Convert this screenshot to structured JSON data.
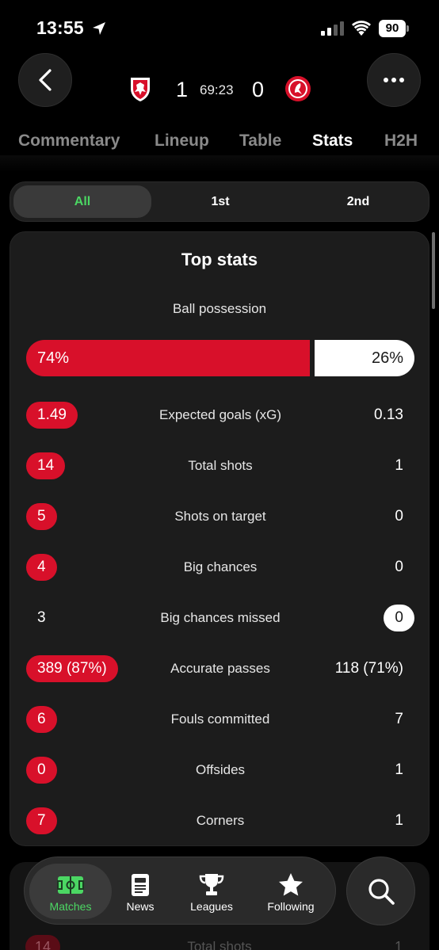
{
  "status_bar": {
    "time": "13:55",
    "battery": "90"
  },
  "header": {
    "home_score": "1",
    "away_score": "0",
    "match_clock": "69:23",
    "home_color": "#d8102a",
    "away_color": "#d8102a"
  },
  "tabs": [
    {
      "label": "Commentary",
      "active": false
    },
    {
      "label": "Lineup",
      "active": false
    },
    {
      "label": "Table",
      "active": false
    },
    {
      "label": "Stats",
      "active": true
    },
    {
      "label": "H2H",
      "active": false
    }
  ],
  "periods": [
    {
      "label": "All",
      "active": true
    },
    {
      "label": "1st",
      "active": false
    },
    {
      "label": "2nd",
      "active": false
    }
  ],
  "top_stats": {
    "title": "Top stats",
    "possession": {
      "label": "Ball possession",
      "home": "74%",
      "away": "26%",
      "home_fraction": 0.74
    },
    "rows": [
      {
        "label": "Expected goals (xG)",
        "home": "1.49",
        "away": "0.13",
        "leader": "home"
      },
      {
        "label": "Total shots",
        "home": "14",
        "away": "1",
        "leader": "home"
      },
      {
        "label": "Shots on target",
        "home": "5",
        "away": "0",
        "leader": "home"
      },
      {
        "label": "Big chances",
        "home": "4",
        "away": "0",
        "leader": "home"
      },
      {
        "label": "Big chances missed",
        "home": "3",
        "away": "0",
        "leader": "away"
      },
      {
        "label": "Accurate passes",
        "home": "389 (87%)",
        "away": "118 (71%)",
        "leader": "home"
      },
      {
        "label": "Fouls committed",
        "home": "6",
        "away": "7",
        "leader": "home"
      },
      {
        "label": "Offsides",
        "home": "0",
        "away": "1",
        "leader": "home"
      },
      {
        "label": "Corners",
        "home": "7",
        "away": "1",
        "leader": "home"
      }
    ]
  },
  "peek": {
    "home": "14",
    "label": "Total shots",
    "away": "1"
  },
  "bottom_nav": {
    "items": [
      {
        "label": "Matches",
        "icon": "pitch-icon",
        "active": true
      },
      {
        "label": "News",
        "icon": "news-icon",
        "active": false
      },
      {
        "label": "Leagues",
        "icon": "trophy-icon",
        "active": false
      },
      {
        "label": "Following",
        "icon": "star-icon",
        "active": false
      }
    ],
    "accent": "#4bd763"
  }
}
